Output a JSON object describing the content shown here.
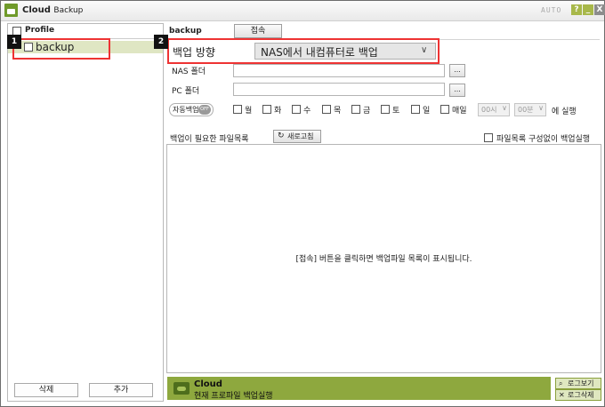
{
  "window": {
    "app_name": "Cloud",
    "app_sub": "Backup",
    "auto_label": "AUTO",
    "help_label": "?",
    "min_label": "_",
    "close_label": "X"
  },
  "badges": {
    "one": "1",
    "two": "2"
  },
  "left_panel": {
    "header_label": "Profile",
    "items": [
      {
        "label": "backup"
      }
    ],
    "delete_button": "삭제",
    "add_button": "추가"
  },
  "main": {
    "profile_name": "backup",
    "connect_button": "접속",
    "direction_label": "백업 방향",
    "direction_value": "NAS에서 내컴퓨터로 백업",
    "nas_folder_label": "NAS 폴더",
    "pc_folder_label": "PC 폴더",
    "browse_label": "...",
    "auto_backup_label": "자동백업",
    "auto_backup_switch": "OFF",
    "days": [
      "월",
      "화",
      "수",
      "목",
      "금",
      "토",
      "일",
      "매일"
    ],
    "hour_value": "00시",
    "minute_value": "00분",
    "run_label": "에 실행",
    "list_label": "백업이 필요한 파일목록",
    "refresh_button": "새로고침",
    "no_list_label": "파일목록 구성없이 백업실행",
    "list_message": "[접속] 버튼을 클릭하면 백업파일 목록이 표시됩니다."
  },
  "status": {
    "title": "Cloud",
    "message": "현재 프로파일 백업실행",
    "log_view": "로그보기",
    "log_delete": "로그삭제"
  },
  "colors": {
    "accent_green": "#8ea83e",
    "selection_bg": "#dfe6c3",
    "highlight_red": "#e33333"
  }
}
